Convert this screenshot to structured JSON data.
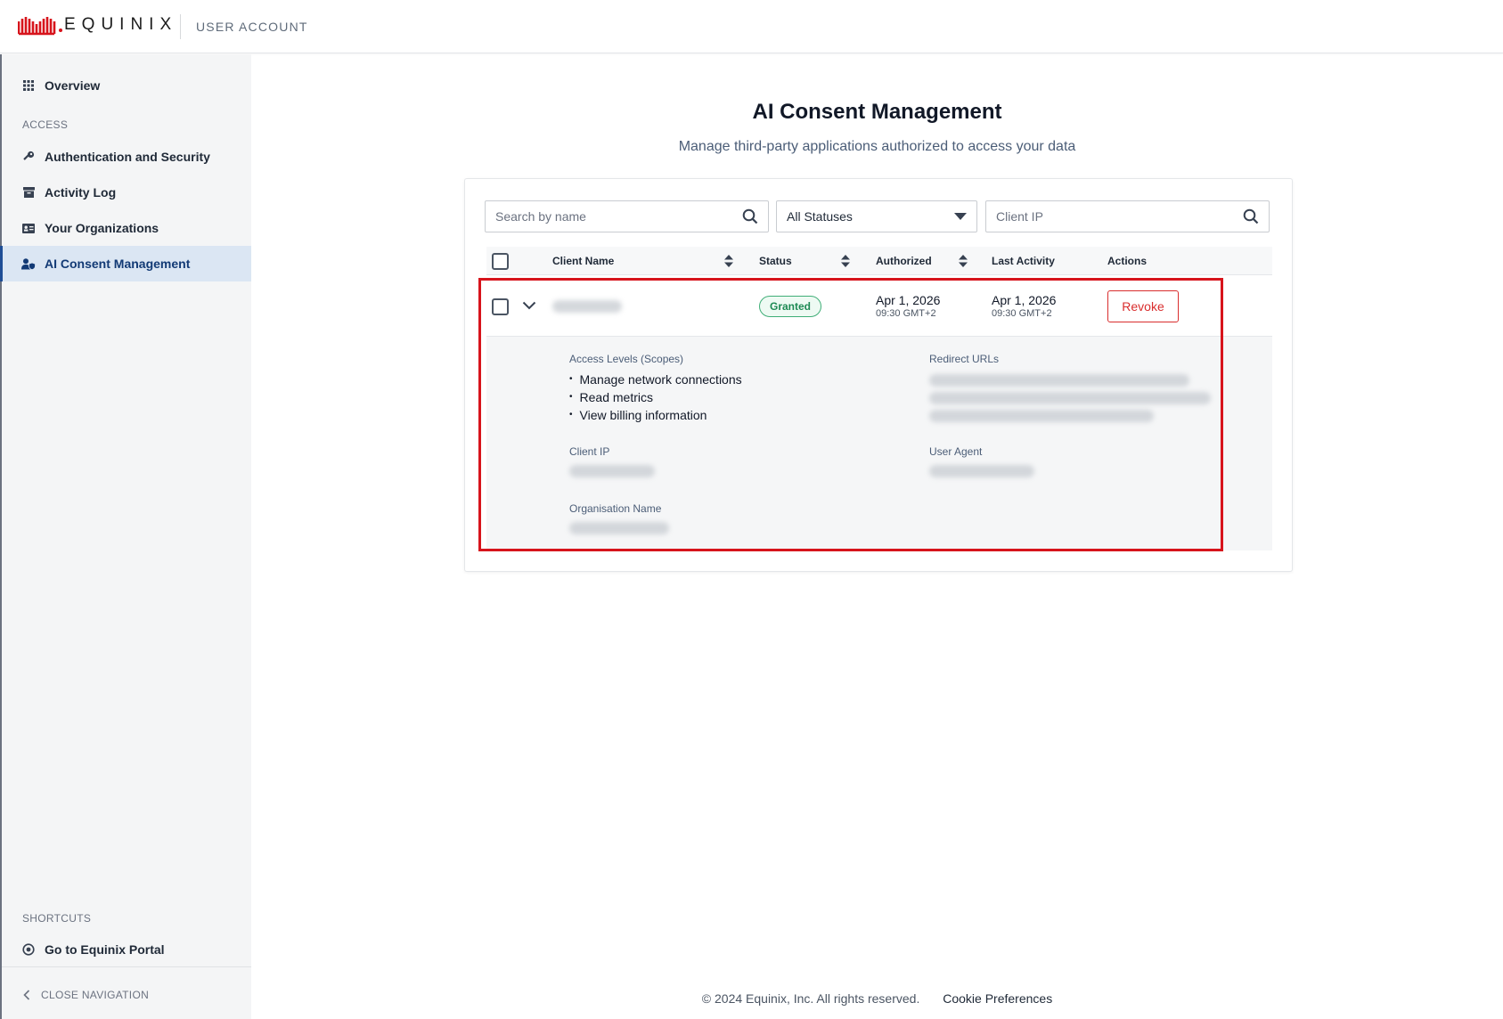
{
  "header": {
    "brand": "EQUINIX",
    "section": "USER ACCOUNT"
  },
  "sidebar": {
    "overview": "Overview",
    "access_label": "ACCESS",
    "items": [
      {
        "label": "Authentication and Security",
        "icon": "key-icon"
      },
      {
        "label": "Activity Log",
        "icon": "archive-icon"
      },
      {
        "label": "Your Organizations",
        "icon": "id-card-icon"
      },
      {
        "label": "AI Consent Management",
        "icon": "user-shield-icon",
        "active": true
      }
    ],
    "shortcuts_label": "SHORTCUTS",
    "portal_link": "Go to Equinix Portal",
    "close_nav": "CLOSE NAVIGATION"
  },
  "main": {
    "title": "AI Consent Management",
    "subtitle": "Manage third-party applications authorized to access your data"
  },
  "filters": {
    "search_placeholder": "Search by name",
    "status_value": "All Statuses",
    "ip_placeholder": "Client IP"
  },
  "table": {
    "columns": {
      "client_name": "Client Name",
      "status": "Status",
      "authorized": "Authorized",
      "last_activity": "Last Activity",
      "actions": "Actions"
    },
    "rows": [
      {
        "status": "Granted",
        "authorized_date": "Apr 1, 2026",
        "authorized_time": "09:30 GMT+2",
        "last_activity_date": "Apr 1, 2026",
        "last_activity_time": "09:30 GMT+2",
        "action": "Revoke",
        "expanded": true,
        "details": {
          "scopes_label": "Access Levels (Scopes)",
          "scopes": [
            "Manage network connections",
            "Read metrics",
            "View billing information"
          ],
          "redirect_label": "Redirect URLs",
          "client_ip_label": "Client IP",
          "user_agent_label": "User Agent",
          "org_label": "Organisation Name"
        }
      }
    ]
  },
  "footer": {
    "copyright": "© 2024 Equinix, Inc. All rights reserved.",
    "cookie": "Cookie Preferences"
  },
  "colors": {
    "brand_red": "#d7141c",
    "active_nav_bg": "#dbe6f3",
    "active_nav_text": "#123a75",
    "granted_green": "#1e8a54",
    "revoke_red": "#d92d2d"
  }
}
